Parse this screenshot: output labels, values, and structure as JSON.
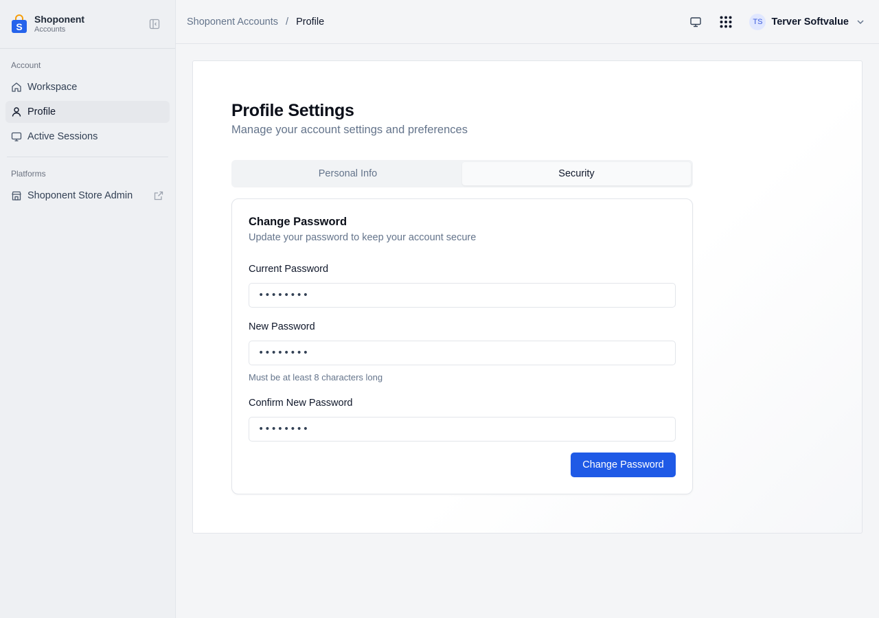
{
  "brand": {
    "name": "Shoponent",
    "sub": "Accounts"
  },
  "sidebar": {
    "account_section": "Account",
    "account_items": [
      {
        "label": "Workspace",
        "icon": "home-icon"
      },
      {
        "label": "Profile",
        "icon": "user-icon",
        "active": true
      },
      {
        "label": "Active Sessions",
        "icon": "monitor-icon"
      }
    ],
    "platforms_section": "Platforms",
    "platform_items": [
      {
        "label": "Shoponent Store Admin",
        "icon": "store-icon",
        "external": true
      }
    ]
  },
  "header": {
    "breadcrumb": [
      "Shoponent Accounts",
      "Profile"
    ],
    "breadcrumb_sep": "/",
    "user": {
      "initials": "TS",
      "name": "Terver Softvalue"
    }
  },
  "page": {
    "title": "Profile Settings",
    "subtitle": "Manage your account settings and preferences",
    "tabs": [
      {
        "label": "Personal Info",
        "active": false
      },
      {
        "label": "Security",
        "active": true
      }
    ]
  },
  "form": {
    "title": "Change Password",
    "subtitle": "Update your password to keep your account secure",
    "fields": [
      {
        "label": "Current Password",
        "value": "••••••••"
      },
      {
        "label": "New Password",
        "value": "••••••••",
        "hint": "Must be at least 8 characters long"
      },
      {
        "label": "Confirm New Password",
        "value": "••••••••"
      }
    ],
    "submit_label": "Change Password"
  },
  "colors": {
    "accent": "#1f5ae6",
    "brand_bag": "#2563eb"
  }
}
